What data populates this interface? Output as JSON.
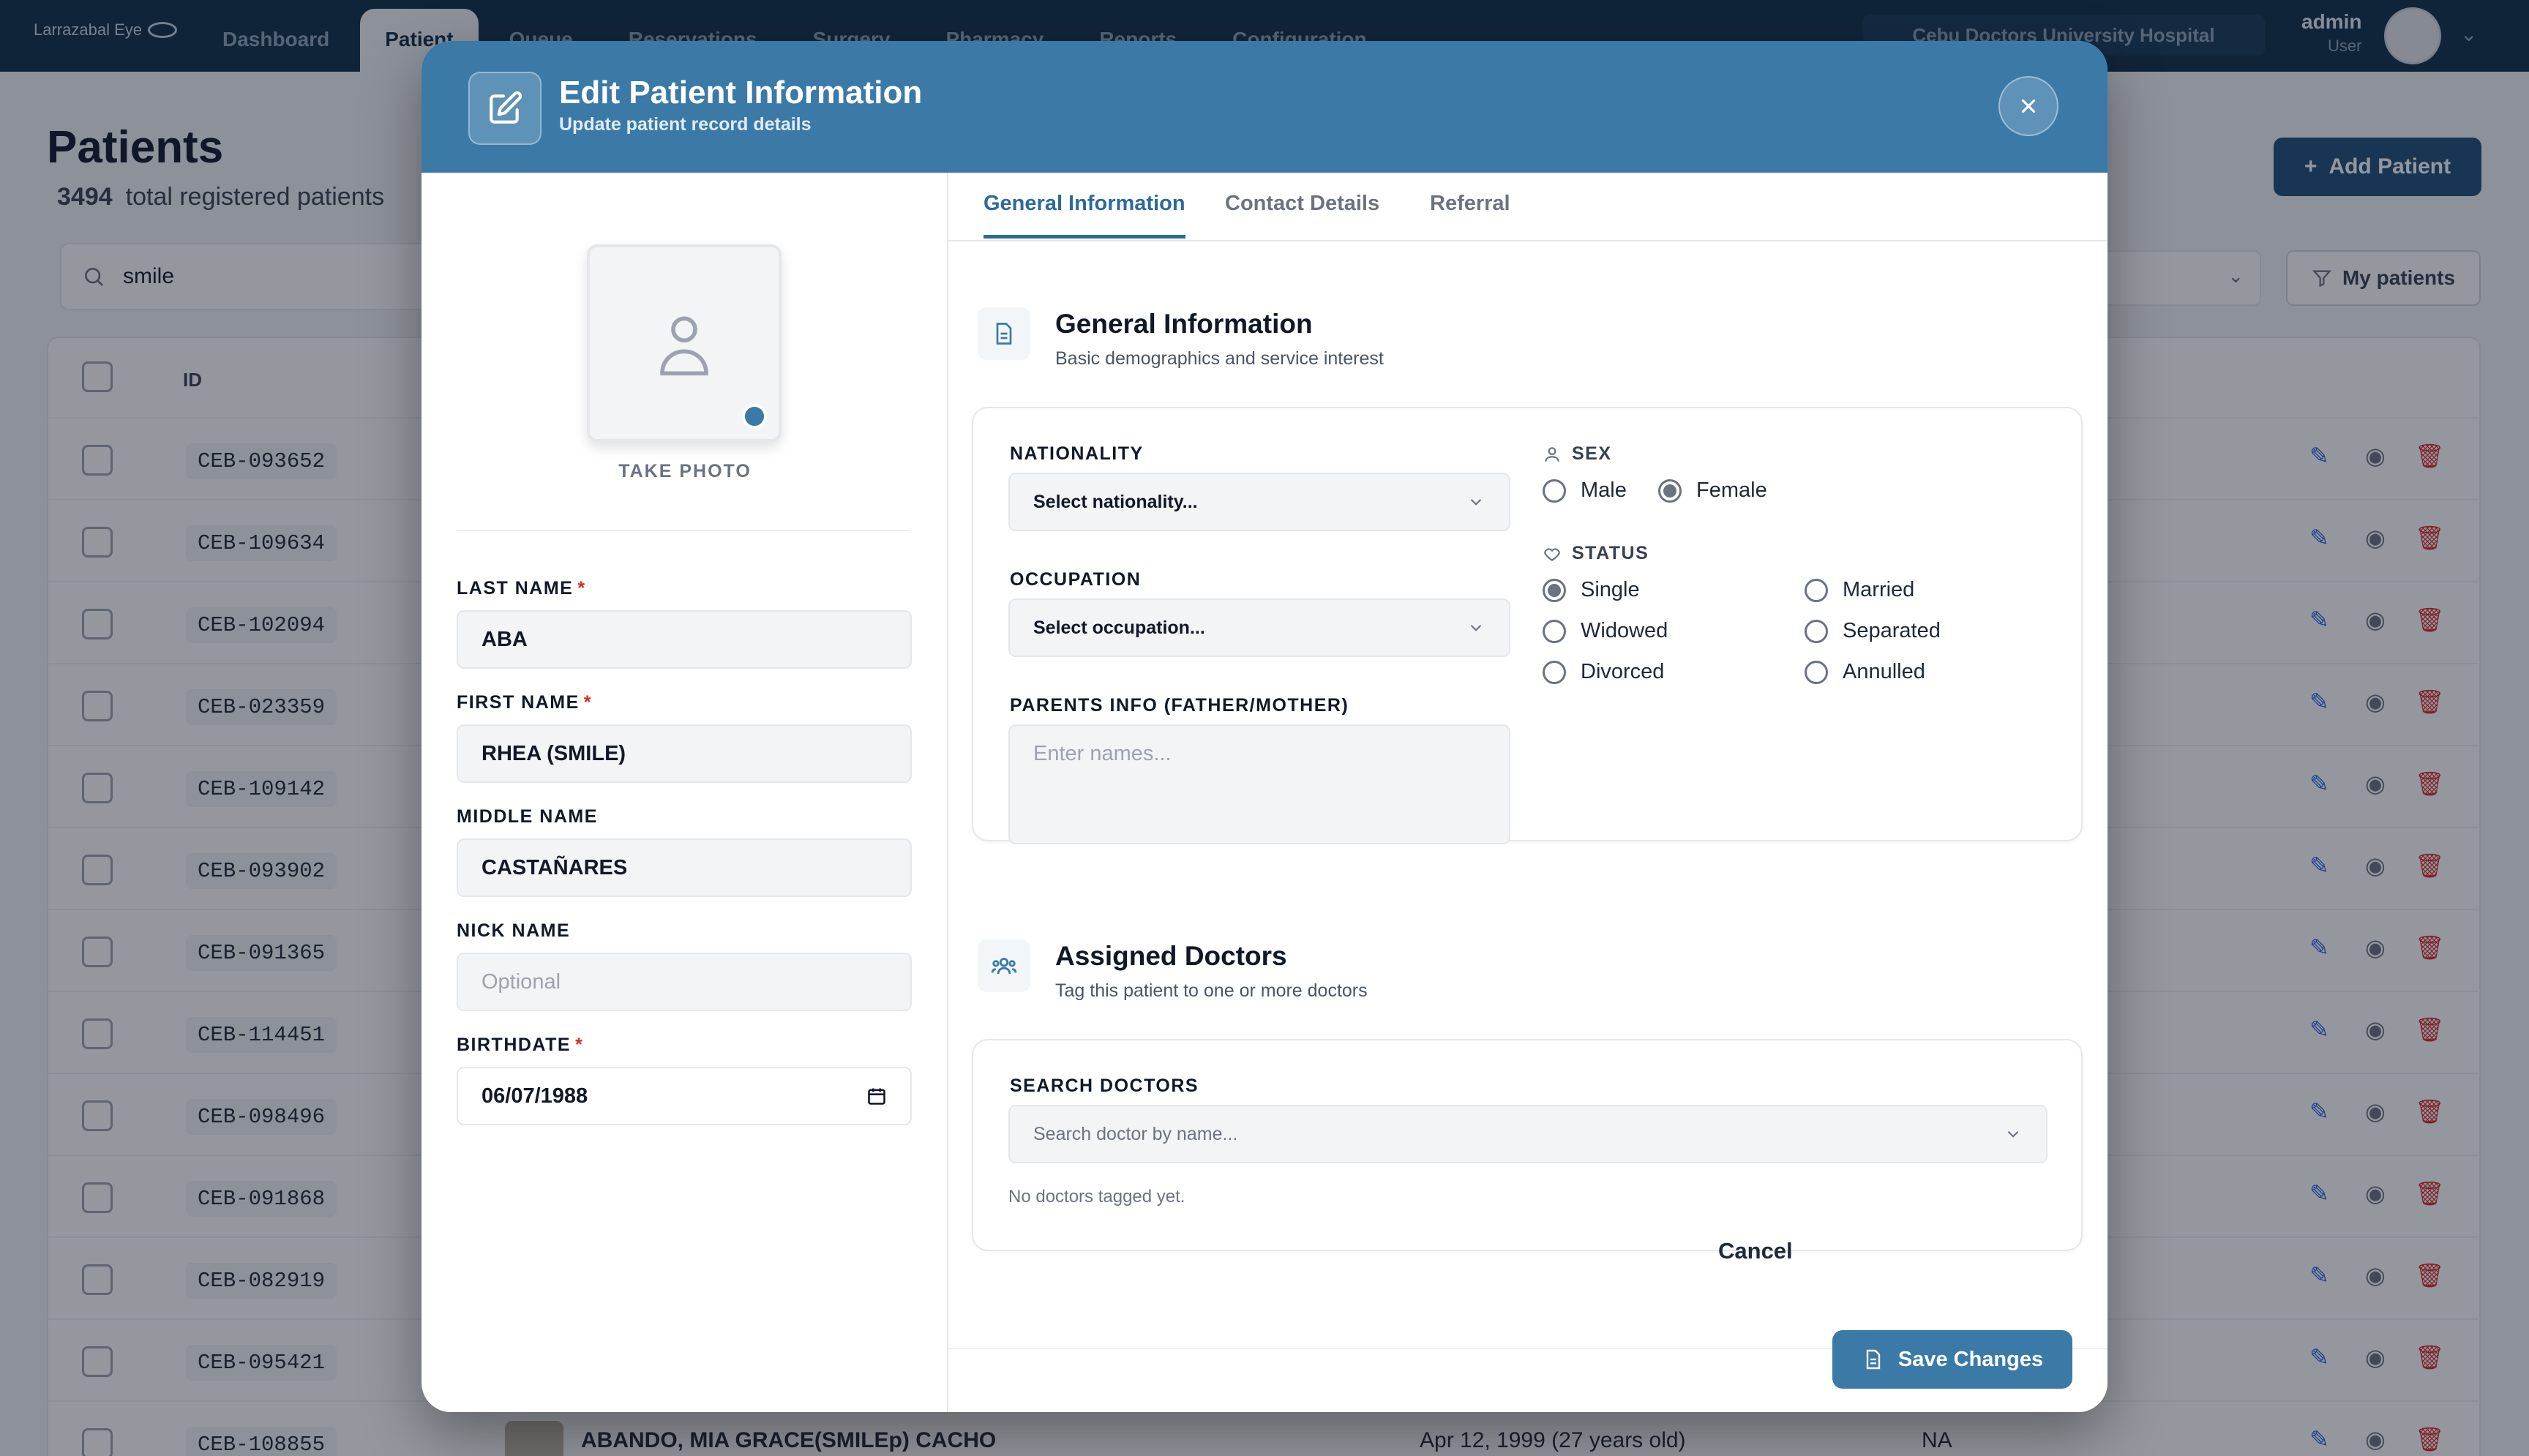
{
  "app": {
    "logo_text": "Larrazabal Eye",
    "nav": [
      "Dashboard",
      "Patient",
      "Queue",
      "Reservations",
      "Surgery",
      "Pharmacy",
      "Reports",
      "Configuration"
    ],
    "hospital": "Cebu Doctors University Hospital",
    "user": {
      "name": "admin",
      "role": "User"
    }
  },
  "page": {
    "title": "Patients",
    "count": "3494",
    "count_label": "total registered patients",
    "add_label": "Add Patient",
    "search_value": "smile",
    "my_patients_label": "My patients",
    "col_id": "ID"
  },
  "rows": [
    {
      "id": "CEB-093652"
    },
    {
      "id": "CEB-109634"
    },
    {
      "id": "CEB-102094"
    },
    {
      "id": "CEB-023359"
    },
    {
      "id": "CEB-109142"
    },
    {
      "id": "CEB-093902"
    },
    {
      "id": "CEB-091365"
    },
    {
      "id": "CEB-114451"
    },
    {
      "id": "CEB-098496"
    },
    {
      "id": "CEB-091868"
    },
    {
      "id": "CEB-082919"
    },
    {
      "id": "CEB-095421"
    },
    {
      "id": "CEB-108855",
      "name": "ABANDO, MIA GRACE(SMILEp) CACHO",
      "birth": "Apr 12, 1999 (27 years old)",
      "extra": "NA"
    }
  ],
  "modal": {
    "title": "Edit Patient Information",
    "subtitle": "Update patient record details",
    "take_photo": "TAKE PHOTO",
    "fields": {
      "last_name": {
        "label": "LAST NAME",
        "value": "ABA"
      },
      "first_name": {
        "label": "FIRST NAME",
        "value": "RHEA (SMILE)"
      },
      "middle_name": {
        "label": "MIDDLE NAME",
        "value": "CASTAÑARES"
      },
      "nick_name": {
        "label": "NICK NAME",
        "placeholder": "Optional"
      },
      "birthdate": {
        "label": "BIRTHDATE",
        "value": "06/07/1988"
      }
    },
    "required_mark": "*",
    "tabs": [
      "General Information",
      "Contact Details",
      "Referral"
    ],
    "general": {
      "title": "General Information",
      "subtitle": "Basic demographics and service interest",
      "nationality_label": "NATIONALITY",
      "nationality_placeholder": "Select nationality...",
      "occupation_label": "OCCUPATION",
      "occupation_placeholder": "Select occupation...",
      "parents_label": "PARENTS INFO (FATHER/MOTHER)",
      "parents_placeholder": "Enter names...",
      "sex_label": "SEX",
      "sex_options": [
        "Male",
        "Female"
      ],
      "sex_selected": "Female",
      "status_label": "STATUS",
      "status_options": [
        "Single",
        "Married",
        "Widowed",
        "Separated",
        "Divorced",
        "Annulled"
      ],
      "status_selected": "Single"
    },
    "doctors": {
      "title": "Assigned Doctors",
      "subtitle": "Tag this patient to one or more doctors",
      "search_label": "SEARCH DOCTORS",
      "search_placeholder": "Search doctor by name...",
      "empty": "No doctors tagged yet."
    },
    "footer": {
      "cancel": "Cancel",
      "save": "Save Changes"
    }
  }
}
